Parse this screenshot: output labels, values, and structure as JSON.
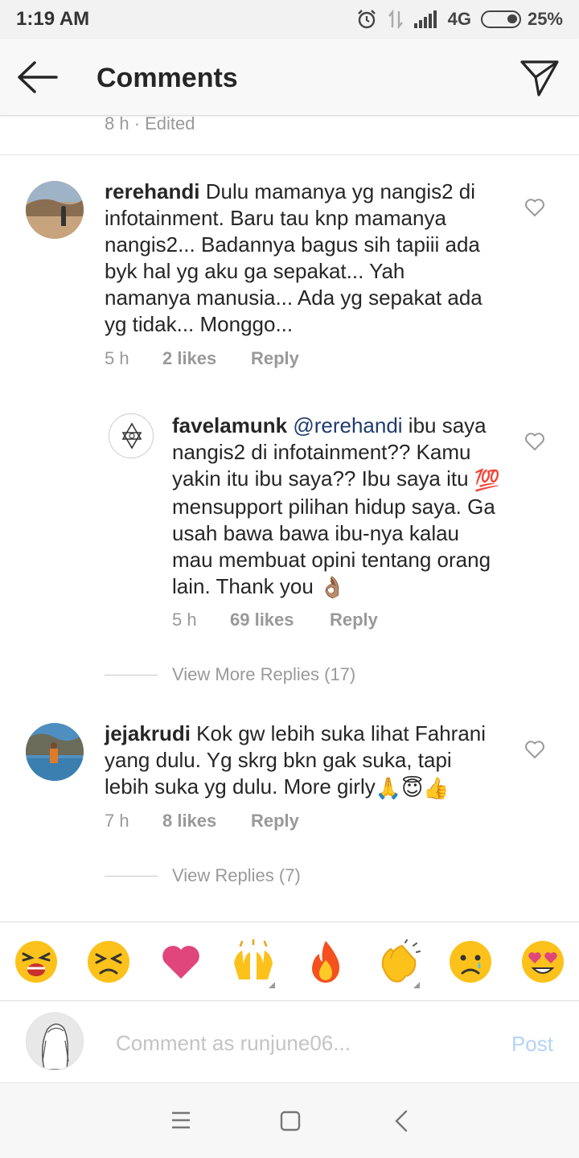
{
  "status": {
    "time": "1:19 AM",
    "network": "4G",
    "battery": "25%"
  },
  "header": {
    "title": "Comments",
    "back_icon": "arrow-left-icon",
    "send_icon": "paper-plane-icon"
  },
  "previous_comment": {
    "meta": "8 h · Edited"
  },
  "comments": [
    {
      "username": "rerehandi",
      "text": "Dulu mamanya yg nangis2 di infotainment. Baru tau knp mamanya nangis2... Badannya bagus sih tapiii ada byk hal yg aku ga sepakat... Yah namanya manusia... Ada yg sepakat ada yg tidak... Monggo...",
      "time": "5 h",
      "likes": "2 likes",
      "reply": "Reply",
      "replies": [
        {
          "username": "favelamunk",
          "mention": "@rerehandi",
          "text_part1": "ibu saya nangis2 di infotainment?? Kamu yakin itu ibu saya?? Ibu saya itu",
          "emoji1": "💯",
          "text_part2": "mensupport pilihan hidup saya. Ga usah bawa bawa ibu-nya kalau mau membuat opini tentang orang lain. Thank you",
          "emoji2": "👌🏽",
          "time": "5 h",
          "likes": "69 likes",
          "reply": "Reply"
        }
      ],
      "view_more": "View More Replies (17)"
    },
    {
      "username": "jejakrudi",
      "text": "Kok gw lebih suka lihat Fahrani yang dulu. Yg skrg bkn gak suka, tapi lebih suka yg dulu. More girly",
      "emojis": "🙏😇👍",
      "time": "7 h",
      "likes": "8 likes",
      "reply": "Reply",
      "view_more": "View Replies (7)"
    }
  ],
  "emoji_bar": [
    "😫",
    "😣",
    "❤️",
    "🙌",
    "🔥",
    "👏",
    "😢",
    "😍"
  ],
  "input": {
    "placeholder": "Comment as runjune06...",
    "post_label": "Post"
  },
  "colors": {
    "mention": "#1f3b6e",
    "meta": "#999999",
    "post_disabled": "#b4d3f5"
  }
}
